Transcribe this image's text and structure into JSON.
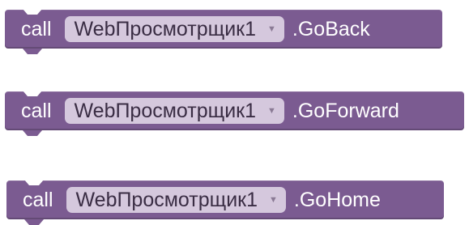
{
  "colors": {
    "block": "#7b5b91",
    "dropdown_bg": "#d5c8dd"
  },
  "blocks": [
    {
      "keyword": "call",
      "component": "WebПросмотрщик1",
      "dropdown_icon": "triangle-down-icon",
      "method": ".GoBack"
    },
    {
      "keyword": "call",
      "component": "WebПросмотрщик1",
      "dropdown_icon": "triangle-down-icon",
      "method": ".GoForward"
    },
    {
      "keyword": "call",
      "component": "WebПросмотрщик1",
      "dropdown_icon": "triangle-down-icon",
      "method": ".GoHome"
    }
  ]
}
